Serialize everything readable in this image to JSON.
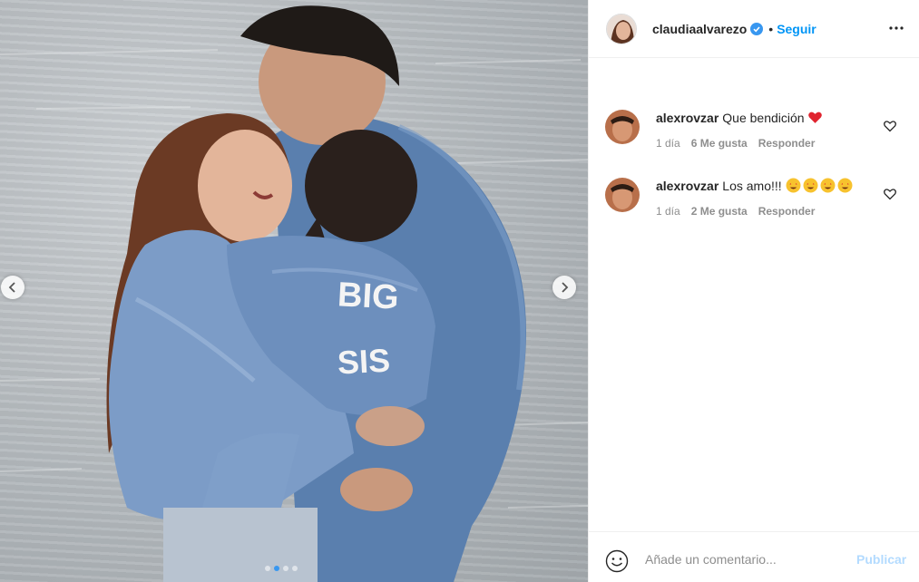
{
  "post": {
    "image_alt": "Family photo: woman and man embracing a child wearing a denim jacket",
    "jacket_text_line1": "BIG",
    "jacket_text_line2": "SIS",
    "carousel": {
      "total": 4,
      "active": 2
    }
  },
  "header": {
    "username": "claudiaalvarezo",
    "separator": "•",
    "follow_label": "Seguir"
  },
  "comments": [
    {
      "user": "alexrovzar",
      "text": "Que bendición",
      "emoji": [
        "red-heart"
      ],
      "time": "1 día",
      "likes": "6 Me gusta",
      "reply": "Responder"
    },
    {
      "user": "alexrovzar",
      "text": "Los amo!!!",
      "emoji": [
        "star-struck",
        "star-struck",
        "star-struck",
        "star-struck"
      ],
      "time": "1 día",
      "likes": "2 Me gusta",
      "reply": "Responder"
    }
  ],
  "composer": {
    "placeholder": "Añade un comentario...",
    "publish_label": "Publicar"
  },
  "colors": {
    "link": "#0095f6",
    "publish_disabled": "#b3dbff",
    "muted": "#8e8e8e"
  }
}
